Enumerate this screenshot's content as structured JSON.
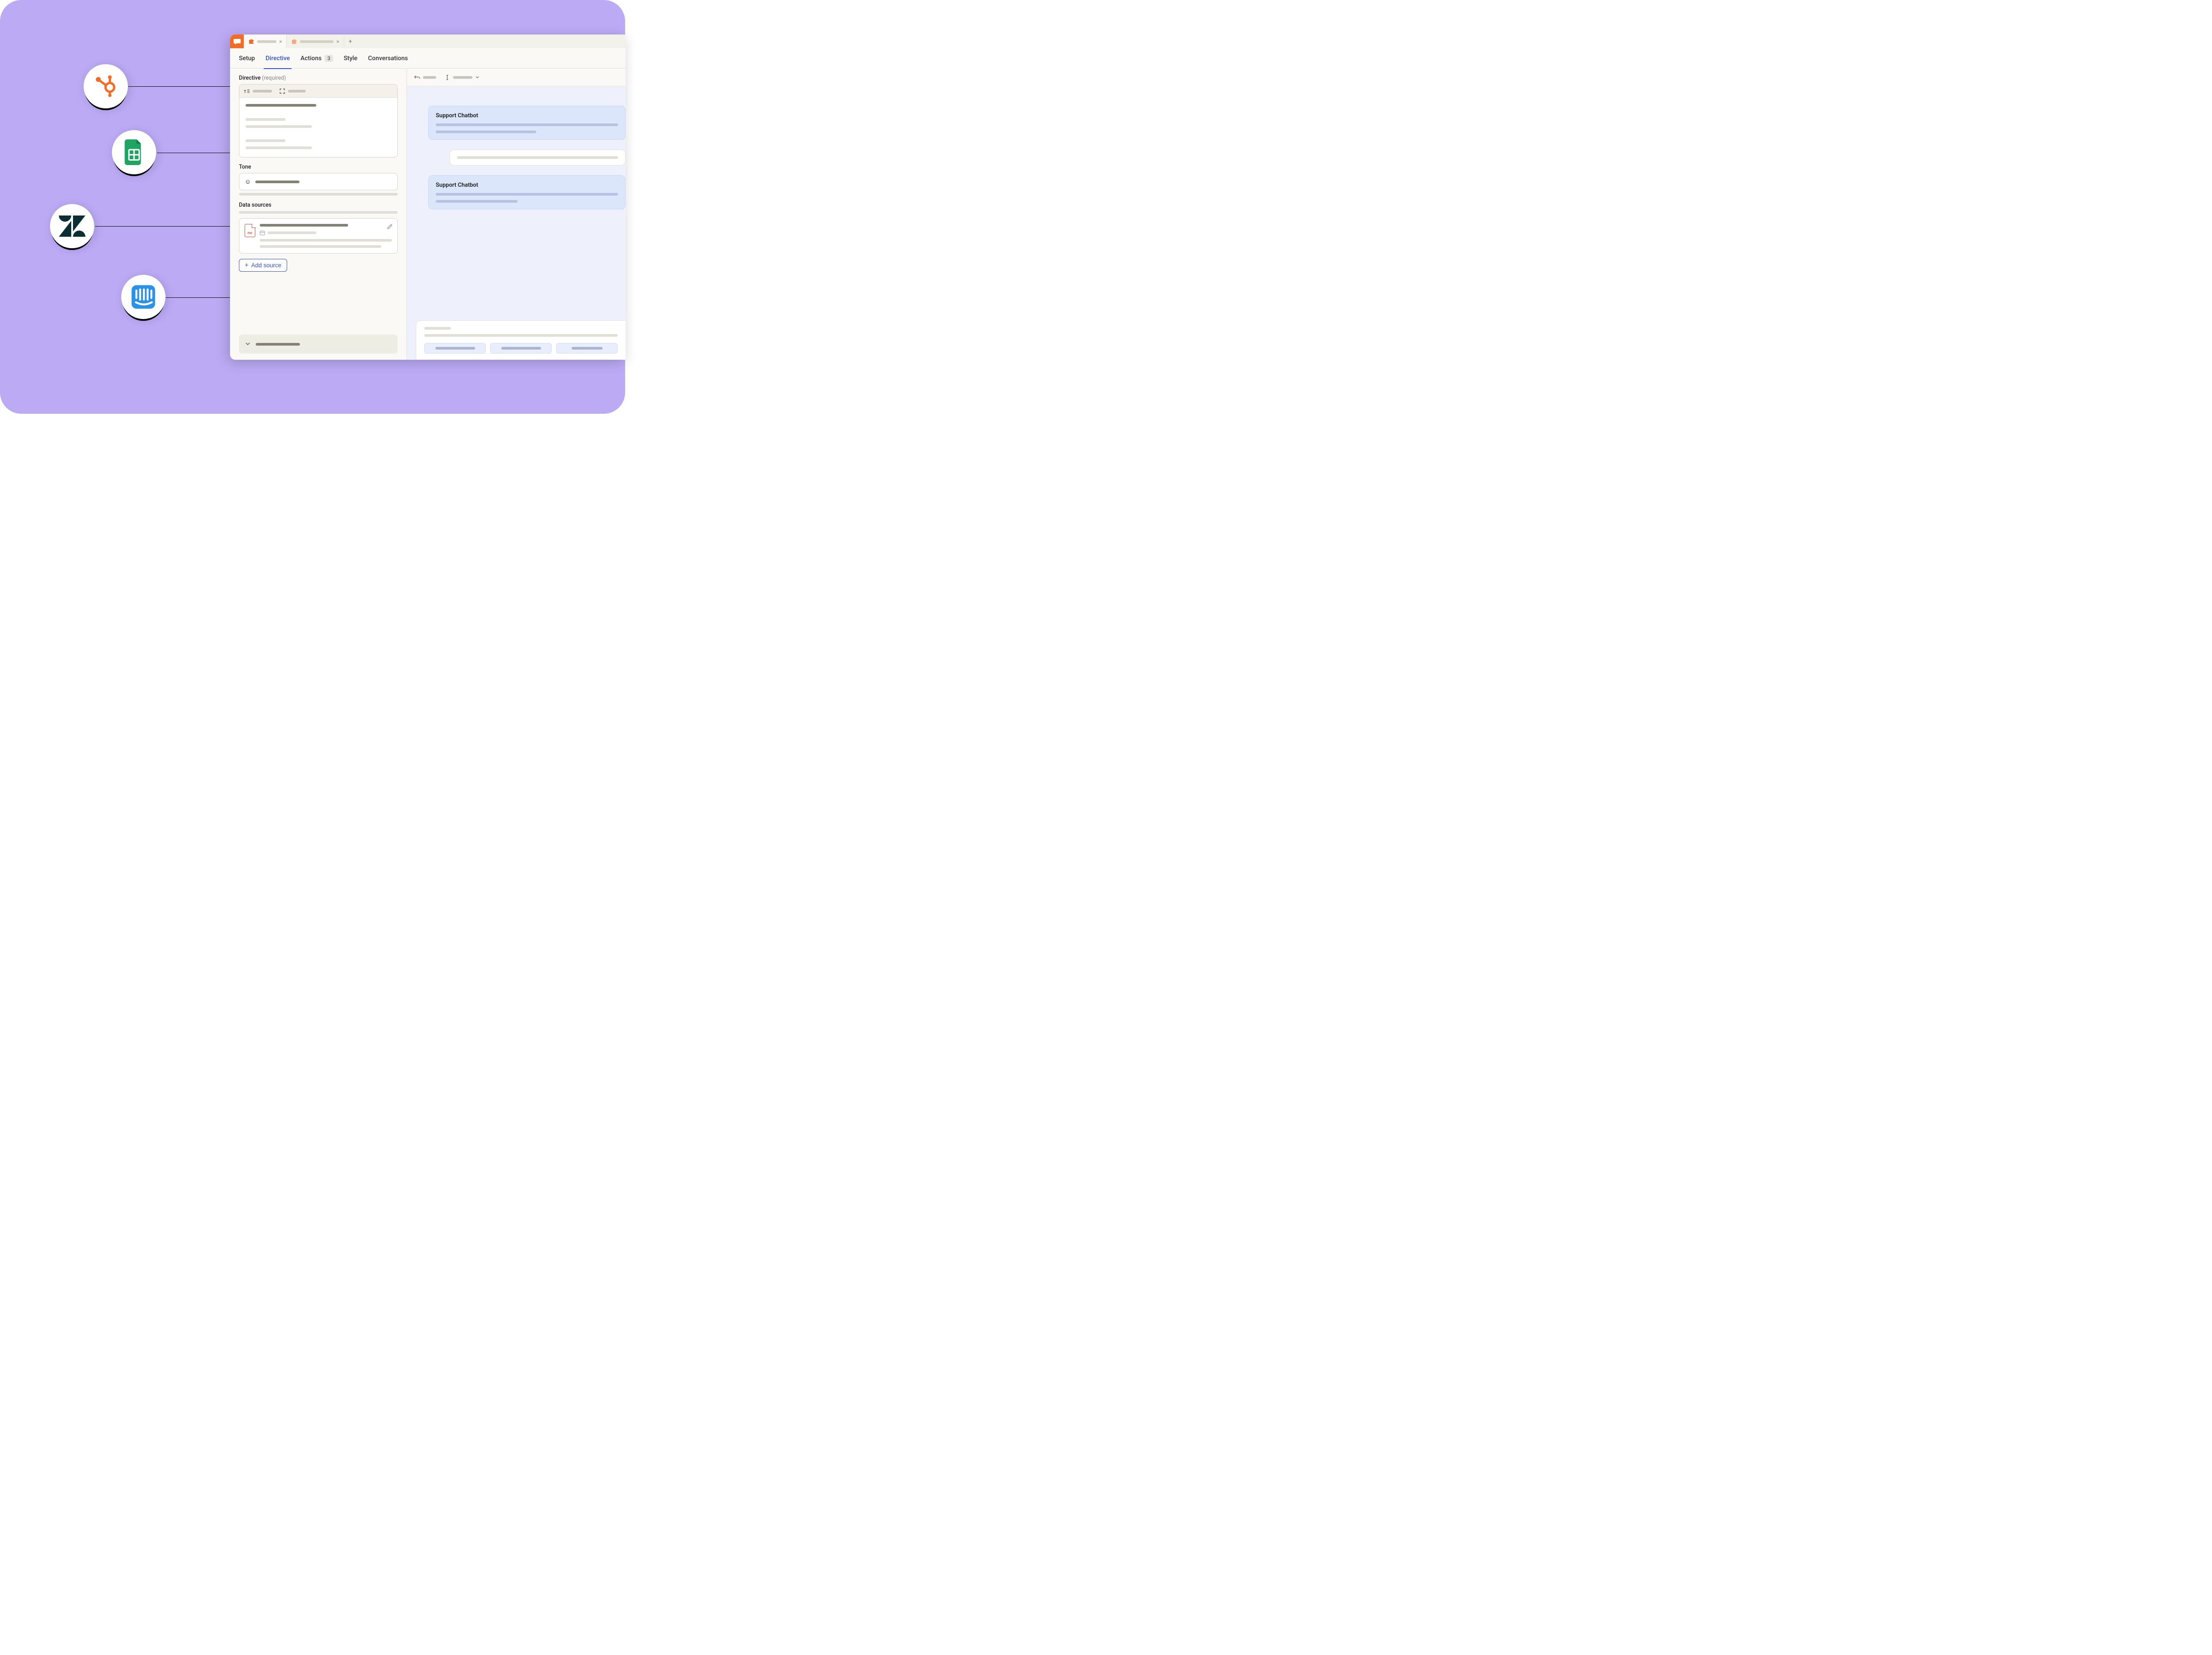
{
  "nav": {
    "setup": "Setup",
    "directive": "Directive",
    "actions": "Actions",
    "actions_count": "3",
    "style": "Style",
    "conversations": "Conversations"
  },
  "sections": {
    "directive_label": "Directive",
    "directive_required": "(required)",
    "tone_label": "Tone",
    "data_sources_label": "Data sources"
  },
  "buttons": {
    "add_source": "Add source"
  },
  "data_source": {
    "filetype": "PDF"
  },
  "chat": {
    "bot_title_1": "Support Chatbot",
    "bot_title_2": "Support Chatbot"
  },
  "integrations": [
    {
      "name": "hubspot"
    },
    {
      "name": "google-sheets"
    },
    {
      "name": "zendesk"
    },
    {
      "name": "intercom"
    }
  ]
}
